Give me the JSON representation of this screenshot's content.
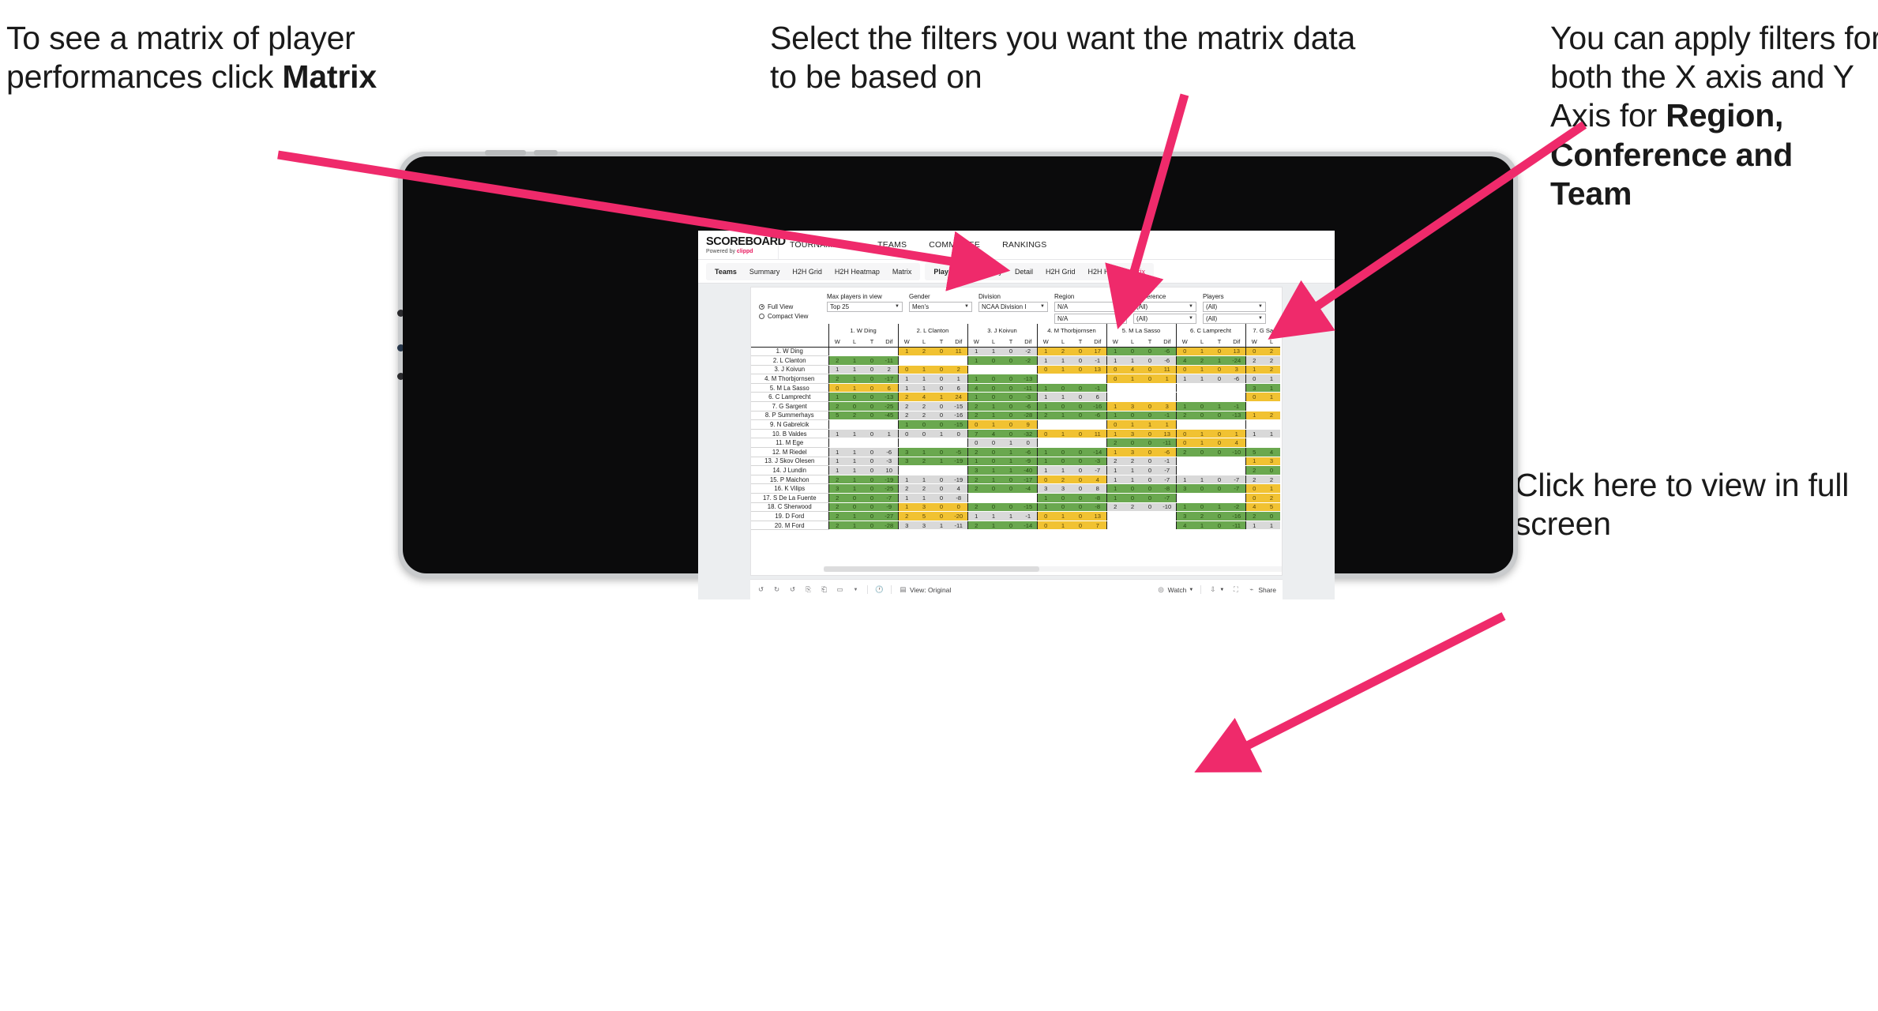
{
  "annotations": {
    "left": {
      "pre": "To see a matrix of player performances click ",
      "bold": "Matrix"
    },
    "middle": {
      "text": "Select the filters you want the matrix data to be based on"
    },
    "right": {
      "pre": "You  can apply filters for both the X axis and Y Axis for ",
      "bold": "Region, Conference and Team"
    },
    "fullscreen": {
      "text": "Click here to view in full screen"
    }
  },
  "brand": {
    "title": "SCOREBOARD",
    "powered_prefix": "Powered by ",
    "powered_name": "clippd"
  },
  "topnav": {
    "items": [
      "TOURNAMENTS",
      "TEAMS",
      "COMMITTEE",
      "RANKINGS"
    ],
    "active": "COMMITTEE"
  },
  "subnav": {
    "teams_group": [
      "Teams",
      "Summary",
      "H2H Grid",
      "H2H Heatmap",
      "Matrix"
    ],
    "players_group": [
      "Players",
      "Summary",
      "Detail",
      "H2H Grid",
      "H2H He",
      "Matrix"
    ],
    "selected": "Matrix"
  },
  "filters": {
    "view_mode": {
      "full": "Full View",
      "compact": "Compact View",
      "selected": "Full View"
    },
    "fields": [
      {
        "label": "Max players in view",
        "value": "Top 25"
      },
      {
        "label": "Gender",
        "value": "Men's"
      },
      {
        "label": "Division",
        "value": "NCAA Division I"
      }
    ],
    "axis_fields": [
      {
        "label": "Region",
        "x": "N/A",
        "y": "N/A"
      },
      {
        "label": "Conference",
        "x": "(All)",
        "y": "(All)"
      },
      {
        "label": "Players",
        "x": "(All)",
        "y": "(All)"
      }
    ]
  },
  "matrix": {
    "sub_headers": [
      "W",
      "L",
      "T",
      "Dif"
    ],
    "columns": [
      "1. W Ding",
      "2. L Clanton",
      "3. J Koivun",
      "4. M Thorbjornsen",
      "5. M La Sasso",
      "6. C Lamprecht",
      "7. G Sa"
    ],
    "rows": [
      "1. W Ding",
      "2. L Clanton",
      "3. J Koivun",
      "4. M Thorbjornsen",
      "5. M La Sasso",
      "6. C Lamprecht",
      "7. G Sargent",
      "8. P Summerhays",
      "9. N Gabrelcik",
      "10. B Valdes",
      "11. M Ege",
      "12. M Riedel",
      "13. J Skov Olesen",
      "14. J Lundin",
      "15. P Maichon",
      "16. K Vilips",
      "17. S De La Fuente",
      "18. C Sherwood",
      "19. D Ford",
      "20. M Ford"
    ],
    "colors": {
      "win": "#6aa84f",
      "loss": "#f1c232",
      "neutral": "#d9d9d9",
      "empty": "#ffffff"
    },
    "cells": [
      [
        {
          "t": "e"
        },
        {
          "t": "y",
          "v": [
            "1",
            "2",
            "0",
            "11"
          ]
        },
        {
          "t": "n",
          "v": [
            "1",
            "1",
            "0",
            "-2"
          ]
        },
        {
          "t": "y",
          "v": [
            "1",
            "2",
            "0",
            "17"
          ]
        },
        {
          "t": "g",
          "v": [
            "1",
            "0",
            "0",
            "-6"
          ]
        },
        {
          "t": "y",
          "v": [
            "0",
            "1",
            "0",
            "13"
          ]
        },
        {
          "t": "y",
          "v": [
            "0",
            "2"
          ]
        }
      ],
      [
        {
          "t": "g",
          "v": [
            "2",
            "1",
            "0",
            "-11"
          ]
        },
        {
          "t": "e"
        },
        {
          "t": "g",
          "v": [
            "1",
            "0",
            "0",
            "-2"
          ]
        },
        {
          "t": "n",
          "v": [
            "1",
            "1",
            "0",
            "-1"
          ]
        },
        {
          "t": "n",
          "v": [
            "1",
            "1",
            "0",
            "-6"
          ]
        },
        {
          "t": "g",
          "v": [
            "4",
            "2",
            "1",
            "-24"
          ]
        },
        {
          "t": "n",
          "v": [
            "2",
            "2"
          ]
        }
      ],
      [
        {
          "t": "n",
          "v": [
            "1",
            "1",
            "0",
            "2"
          ]
        },
        {
          "t": "y",
          "v": [
            "0",
            "1",
            "0",
            "2"
          ]
        },
        {
          "t": "e"
        },
        {
          "t": "y",
          "v": [
            "0",
            "1",
            "0",
            "13"
          ]
        },
        {
          "t": "y",
          "v": [
            "0",
            "4",
            "0",
            "11"
          ]
        },
        {
          "t": "y",
          "v": [
            "0",
            "1",
            "0",
            "3"
          ]
        },
        {
          "t": "y",
          "v": [
            "1",
            "2"
          ]
        }
      ],
      [
        {
          "t": "g",
          "v": [
            "2",
            "1",
            "0",
            "-17"
          ]
        },
        {
          "t": "n",
          "v": [
            "1",
            "1",
            "0",
            "1"
          ]
        },
        {
          "t": "g",
          "v": [
            "1",
            "0",
            "0",
            "-13"
          ]
        },
        {
          "t": "e"
        },
        {
          "t": "y",
          "v": [
            "0",
            "1",
            "0",
            "1"
          ]
        },
        {
          "t": "n",
          "v": [
            "1",
            "1",
            "0",
            "-6"
          ]
        },
        {
          "t": "n",
          "v": [
            "0",
            "1"
          ]
        }
      ],
      [
        {
          "t": "y",
          "v": [
            "0",
            "1",
            "0",
            "6"
          ]
        },
        {
          "t": "n",
          "v": [
            "1",
            "1",
            "0",
            "6"
          ]
        },
        {
          "t": "g",
          "v": [
            "4",
            "0",
            "0",
            "-11"
          ]
        },
        {
          "t": "g",
          "v": [
            "1",
            "0",
            "0",
            "-1"
          ]
        },
        {
          "t": "e"
        },
        {
          "t": "e"
        },
        {
          "t": "g",
          "v": [
            "3",
            "1"
          ]
        }
      ],
      [
        {
          "t": "g",
          "v": [
            "1",
            "0",
            "0",
            "-13"
          ]
        },
        {
          "t": "y",
          "v": [
            "2",
            "4",
            "1",
            "24"
          ]
        },
        {
          "t": "g",
          "v": [
            "1",
            "0",
            "0",
            "-3"
          ]
        },
        {
          "t": "n",
          "v": [
            "1",
            "1",
            "0",
            "6"
          ]
        },
        {
          "t": "e"
        },
        {
          "t": "e"
        },
        {
          "t": "y",
          "v": [
            "0",
            "1"
          ]
        }
      ],
      [
        {
          "t": "g",
          "v": [
            "2",
            "0",
            "0",
            "-25"
          ]
        },
        {
          "t": "n",
          "v": [
            "2",
            "2",
            "0",
            "-15"
          ]
        },
        {
          "t": "g",
          "v": [
            "2",
            "1",
            "0",
            "-6"
          ]
        },
        {
          "t": "g",
          "v": [
            "1",
            "0",
            "0",
            "-16"
          ]
        },
        {
          "t": "y",
          "v": [
            "1",
            "3",
            "0",
            "3"
          ]
        },
        {
          "t": "g",
          "v": [
            "1",
            "0",
            "1",
            "-1"
          ]
        },
        {
          "t": "e"
        }
      ],
      [
        {
          "t": "g",
          "v": [
            "5",
            "2",
            "0",
            "-45"
          ]
        },
        {
          "t": "n",
          "v": [
            "2",
            "2",
            "0",
            "-16"
          ]
        },
        {
          "t": "g",
          "v": [
            "2",
            "1",
            "0",
            "-28"
          ]
        },
        {
          "t": "g",
          "v": [
            "2",
            "1",
            "0",
            "-6"
          ]
        },
        {
          "t": "g",
          "v": [
            "1",
            "0",
            "0",
            "-1"
          ]
        },
        {
          "t": "g",
          "v": [
            "2",
            "0",
            "0",
            "-13"
          ]
        },
        {
          "t": "y",
          "v": [
            "1",
            "2"
          ]
        }
      ],
      [
        {
          "t": "e"
        },
        {
          "t": "g",
          "v": [
            "1",
            "0",
            "0",
            "-15"
          ]
        },
        {
          "t": "y",
          "v": [
            "0",
            "1",
            "0",
            "9"
          ]
        },
        {
          "t": "e"
        },
        {
          "t": "y",
          "v": [
            "0",
            "1",
            "1",
            "1"
          ]
        },
        {
          "t": "e"
        },
        {
          "t": "e"
        }
      ],
      [
        {
          "t": "n",
          "v": [
            "1",
            "1",
            "0",
            "1"
          ]
        },
        {
          "t": "n",
          "v": [
            "0",
            "0",
            "1",
            "0"
          ]
        },
        {
          "t": "g",
          "v": [
            "7",
            "4",
            "0",
            "-32"
          ]
        },
        {
          "t": "y",
          "v": [
            "0",
            "1",
            "0",
            "11"
          ]
        },
        {
          "t": "y",
          "v": [
            "1",
            "3",
            "0",
            "13"
          ]
        },
        {
          "t": "y",
          "v": [
            "0",
            "1",
            "0",
            "1"
          ]
        },
        {
          "t": "n",
          "v": [
            "1",
            "1"
          ]
        }
      ],
      [
        {
          "t": "e"
        },
        {
          "t": "e"
        },
        {
          "t": "n",
          "v": [
            "0",
            "0",
            "1",
            "0"
          ]
        },
        {
          "t": "e"
        },
        {
          "t": "g",
          "v": [
            "2",
            "0",
            "0",
            "-11"
          ]
        },
        {
          "t": "y",
          "v": [
            "0",
            "1",
            "0",
            "4"
          ]
        },
        {
          "t": "e"
        }
      ],
      [
        {
          "t": "n",
          "v": [
            "1",
            "1",
            "0",
            "-6"
          ]
        },
        {
          "t": "g",
          "v": [
            "3",
            "1",
            "0",
            "-5"
          ]
        },
        {
          "t": "g",
          "v": [
            "2",
            "0",
            "1",
            "-6"
          ]
        },
        {
          "t": "g",
          "v": [
            "1",
            "0",
            "0",
            "-14"
          ]
        },
        {
          "t": "y",
          "v": [
            "1",
            "3",
            "0",
            "-6"
          ]
        },
        {
          "t": "g",
          "v": [
            "2",
            "0",
            "0",
            "-10"
          ]
        },
        {
          "t": "g",
          "v": [
            "5",
            "4"
          ]
        }
      ],
      [
        {
          "t": "n",
          "v": [
            "1",
            "1",
            "0",
            "-3"
          ]
        },
        {
          "t": "g",
          "v": [
            "3",
            "2",
            "1",
            "-19"
          ]
        },
        {
          "t": "g",
          "v": [
            "1",
            "0",
            "1",
            "-9"
          ]
        },
        {
          "t": "g",
          "v": [
            "1",
            "0",
            "0",
            "-3"
          ]
        },
        {
          "t": "n",
          "v": [
            "2",
            "2",
            "0",
            "-1"
          ]
        },
        {
          "t": "e"
        },
        {
          "t": "y",
          "v": [
            "1",
            "3"
          ]
        }
      ],
      [
        {
          "t": "n",
          "v": [
            "1",
            "1",
            "0",
            "10"
          ]
        },
        {
          "t": "e"
        },
        {
          "t": "g",
          "v": [
            "3",
            "1",
            "1",
            "-40"
          ]
        },
        {
          "t": "n",
          "v": [
            "1",
            "1",
            "0",
            "-7"
          ]
        },
        {
          "t": "n",
          "v": [
            "1",
            "1",
            "0",
            "-7"
          ]
        },
        {
          "t": "e"
        },
        {
          "t": "g",
          "v": [
            "2",
            "0"
          ]
        }
      ],
      [
        {
          "t": "g",
          "v": [
            "2",
            "1",
            "0",
            "-19"
          ]
        },
        {
          "t": "n",
          "v": [
            "1",
            "1",
            "0",
            "-19"
          ]
        },
        {
          "t": "g",
          "v": [
            "2",
            "1",
            "0",
            "-17"
          ]
        },
        {
          "t": "y",
          "v": [
            "0",
            "2",
            "0",
            "4"
          ]
        },
        {
          "t": "n",
          "v": [
            "1",
            "1",
            "0",
            "-7"
          ]
        },
        {
          "t": "n",
          "v": [
            "1",
            "1",
            "0",
            "-7"
          ]
        },
        {
          "t": "n",
          "v": [
            "2",
            "2"
          ]
        }
      ],
      [
        {
          "t": "g",
          "v": [
            "3",
            "1",
            "0",
            "-25"
          ]
        },
        {
          "t": "n",
          "v": [
            "2",
            "2",
            "0",
            "4"
          ]
        },
        {
          "t": "g",
          "v": [
            "2",
            "0",
            "0",
            "-4"
          ]
        },
        {
          "t": "n",
          "v": [
            "3",
            "3",
            "0",
            "8"
          ]
        },
        {
          "t": "g",
          "v": [
            "1",
            "0",
            "0",
            "-8"
          ]
        },
        {
          "t": "g",
          "v": [
            "3",
            "0",
            "0",
            "-7"
          ]
        },
        {
          "t": "y",
          "v": [
            "0",
            "1"
          ]
        }
      ],
      [
        {
          "t": "g",
          "v": [
            "2",
            "0",
            "0",
            "-7"
          ]
        },
        {
          "t": "n",
          "v": [
            "1",
            "1",
            "0",
            "-8"
          ]
        },
        {
          "t": "e"
        },
        {
          "t": "g",
          "v": [
            "1",
            "0",
            "0",
            "-8"
          ]
        },
        {
          "t": "g",
          "v": [
            "1",
            "0",
            "0",
            "-7"
          ]
        },
        {
          "t": "e"
        },
        {
          "t": "y",
          "v": [
            "0",
            "2"
          ]
        }
      ],
      [
        {
          "t": "g",
          "v": [
            "2",
            "0",
            "0",
            "-9"
          ]
        },
        {
          "t": "y",
          "v": [
            "1",
            "3",
            "0",
            "0"
          ]
        },
        {
          "t": "g",
          "v": [
            "2",
            "0",
            "0",
            "-15"
          ]
        },
        {
          "t": "g",
          "v": [
            "1",
            "0",
            "0",
            "-8"
          ]
        },
        {
          "t": "n",
          "v": [
            "2",
            "2",
            "0",
            "-10"
          ]
        },
        {
          "t": "g",
          "v": [
            "1",
            "0",
            "1",
            "-2"
          ]
        },
        {
          "t": "y",
          "v": [
            "4",
            "5"
          ]
        }
      ],
      [
        {
          "t": "g",
          "v": [
            "2",
            "1",
            "0",
            "-27"
          ]
        },
        {
          "t": "y",
          "v": [
            "2",
            "5",
            "0",
            "-20"
          ]
        },
        {
          "t": "n",
          "v": [
            "1",
            "1",
            "1",
            "-1"
          ]
        },
        {
          "t": "y",
          "v": [
            "0",
            "1",
            "0",
            "13"
          ]
        },
        {
          "t": "e"
        },
        {
          "t": "g",
          "v": [
            "3",
            "2",
            "0",
            "-16"
          ]
        },
        {
          "t": "g",
          "v": [
            "2",
            "0"
          ]
        }
      ],
      [
        {
          "t": "g",
          "v": [
            "2",
            "1",
            "0",
            "-28"
          ]
        },
        {
          "t": "n",
          "v": [
            "3",
            "3",
            "1",
            "-11"
          ]
        },
        {
          "t": "g",
          "v": [
            "2",
            "1",
            "0",
            "-14"
          ]
        },
        {
          "t": "y",
          "v": [
            "0",
            "1",
            "0",
            "7"
          ]
        },
        {
          "t": "e"
        },
        {
          "t": "g",
          "v": [
            "4",
            "1",
            "0",
            "-11"
          ]
        },
        {
          "t": "n",
          "v": [
            "1",
            "1"
          ]
        }
      ]
    ]
  },
  "bottom_toolbar": {
    "view_label": "View: Original",
    "watch_label": "Watch",
    "share_label": "Share",
    "icons": [
      "undo-icon",
      "redo-icon",
      "revert-icon",
      "pause-refresh-icon",
      "resume-refresh-icon",
      "tablet-layout-icon",
      "history-icon"
    ]
  }
}
